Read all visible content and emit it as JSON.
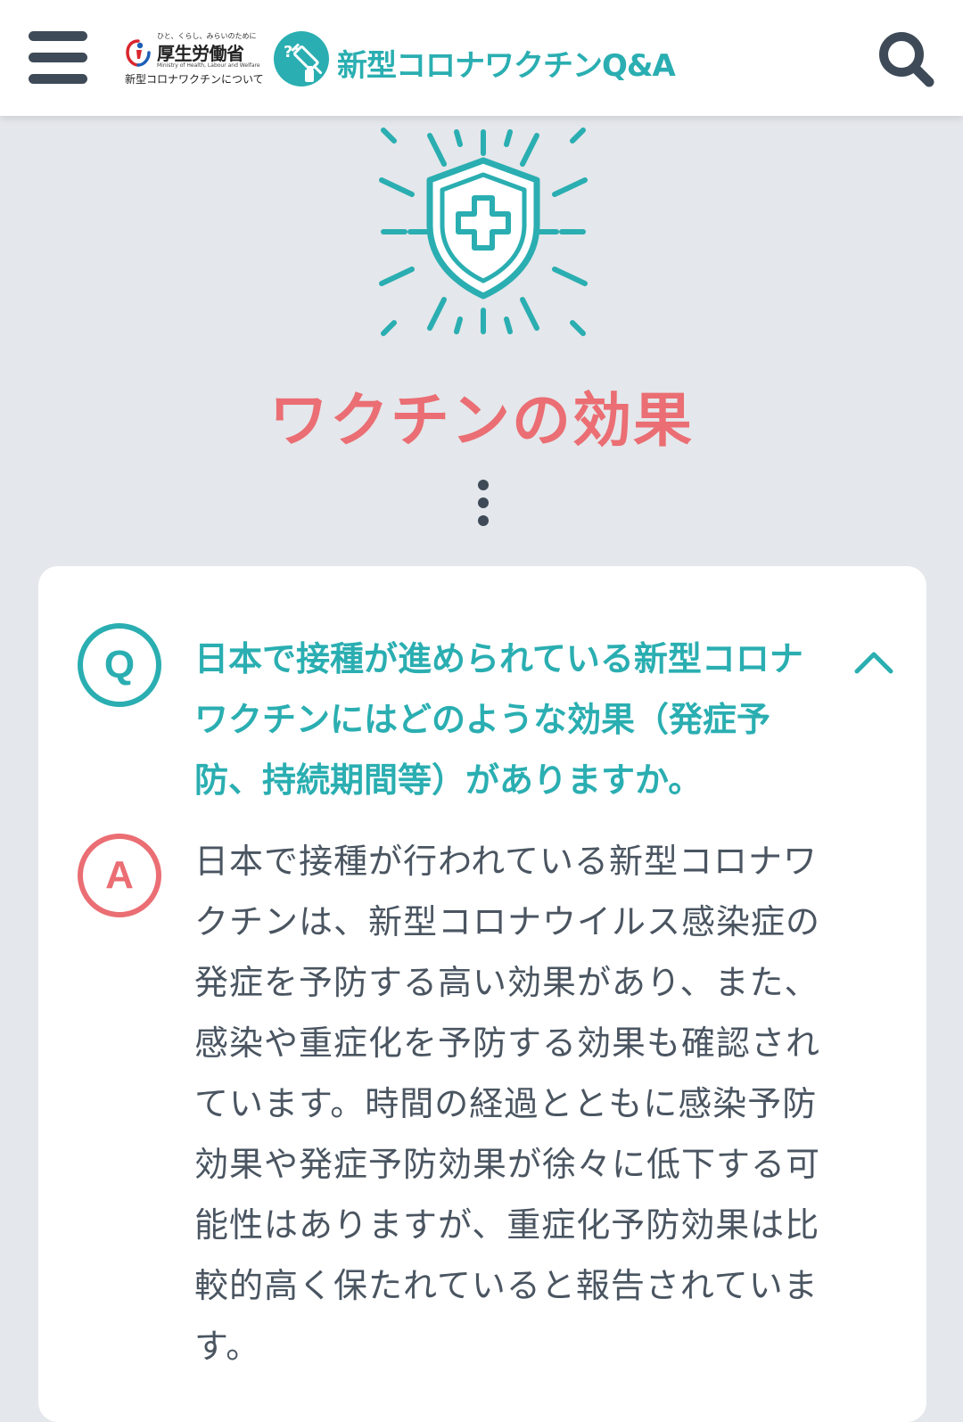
{
  "header": {
    "menu_icon": "hamburger-menu-icon",
    "ministry": {
      "tagline": "ひと、くらし、みらいのために",
      "name": "厚生労働省",
      "english": "Ministry of Health, Labour and Welfare",
      "subtitle": "新型コロナワクチンについて"
    },
    "site_title": "新型コロナワクチンQ&A",
    "site_logo_icon": "vaccine-syringe-icon",
    "search_icon": "search-icon"
  },
  "hero": {
    "icon": "shield-cross-icon",
    "title": "ワクチンの効果"
  },
  "faq": {
    "q_badge": "Q",
    "question": "日本で接種が進められている新型コロナワクチンにはどのような効果（発症予防、持続期間等）がありますか。",
    "a_badge": "A",
    "answer": "日本で接種が行われている新型コロナワクチンは、新型コロナウイルス感染症の発症を予防する高い効果があり、また、感染や重症化を予防する効果も確認されています。時間の経過とともに感染予防効果や発症予防効果が徐々に低下する可能性はありますが、重症化予防効果は比較的高く保たれていると報告されています。",
    "toggle_icon": "chevron-up-icon"
  },
  "colors": {
    "teal": "#2aaeb1",
    "coral": "#ea6e73",
    "dark": "#3e4a57",
    "background": "#e4e7eb"
  }
}
